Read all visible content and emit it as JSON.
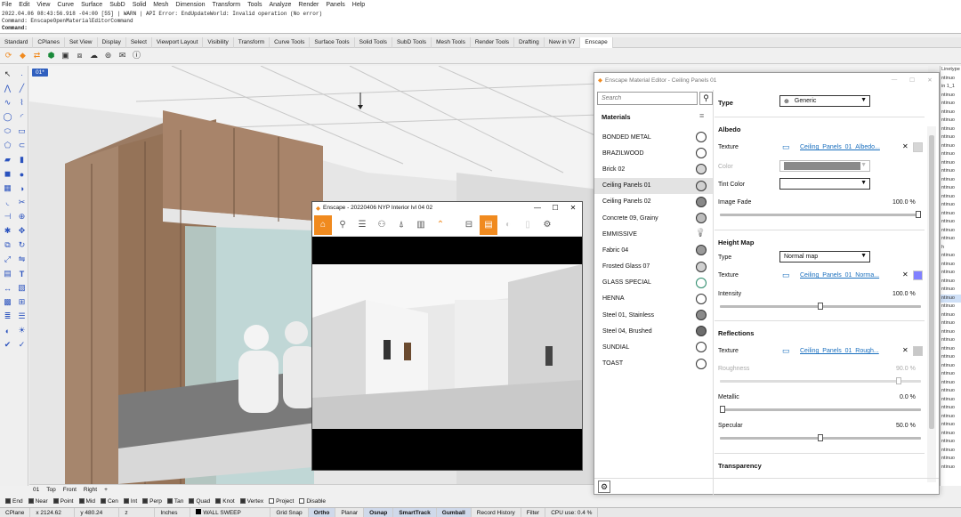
{
  "menu": [
    "File",
    "Edit",
    "View",
    "Curve",
    "Surface",
    "SubD",
    "Solid",
    "Mesh",
    "Dimension",
    "Transform",
    "Tools",
    "Analyze",
    "Render",
    "Panels",
    "Help"
  ],
  "command_history": [
    "2022.04.06 08:43:56.918 -04:00 [55] | WARN | API Error: EndUpdateWorld: Invalid operation (No error)",
    "Command: EnscapeOpenMaterialEditorCommand"
  ],
  "command_prompt": "Command:",
  "toolbar_tabs": [
    "Standard",
    "CPlanes",
    "Set View",
    "Display",
    "Select",
    "Viewport Layout",
    "Visibility",
    "Transform",
    "Curve Tools",
    "Surface Tools",
    "Solid Tools",
    "SubD Tools",
    "Mesh Tools",
    "Render Tools",
    "Drafting",
    "New in V7",
    "Enscape"
  ],
  "active_toolbar_tab": "Enscape",
  "viewport": {
    "label": "01*"
  },
  "view_tabs": [
    "01",
    "Top",
    "Front",
    "Right",
    "+"
  ],
  "osnaps": [
    {
      "label": "End",
      "on": true
    },
    {
      "label": "Near",
      "on": true
    },
    {
      "label": "Point",
      "on": true
    },
    {
      "label": "Mid",
      "on": true
    },
    {
      "label": "Cen",
      "on": true
    },
    {
      "label": "Int",
      "on": true
    },
    {
      "label": "Perp",
      "on": true
    },
    {
      "label": "Tan",
      "on": true
    },
    {
      "label": "Quad",
      "on": true
    },
    {
      "label": "Knot",
      "on": true
    },
    {
      "label": "Vertex",
      "on": true
    },
    {
      "label": "Project",
      "on": false
    },
    {
      "label": "Disable",
      "on": false
    }
  ],
  "status": {
    "cplane": "CPlane",
    "x": "x 2124.62",
    "y": "y 480.24",
    "z": "z",
    "units": "Inches",
    "layer": "WALL SWEEP",
    "toggles": [
      {
        "label": "Grid Snap",
        "on": false
      },
      {
        "label": "Ortho",
        "on": true
      },
      {
        "label": "Planar",
        "on": false
      },
      {
        "label": "Osnap",
        "on": true
      },
      {
        "label": "SmartTrack",
        "on": true
      },
      {
        "label": "Gumball",
        "on": true
      },
      {
        "label": "Record History",
        "on": false
      },
      {
        "label": "Filter",
        "on": false
      }
    ],
    "cpu": "CPU use: 0.4 %"
  },
  "render_window": {
    "title": "Enscape - 20220406 NYP Interior lvl 04 02",
    "controls": [
      "—",
      "☐",
      "✕"
    ]
  },
  "material_editor": {
    "title": "Enscape Material Editor - Ceiling Panels 01",
    "search_placeholder": "Search",
    "materials_header": "Materials",
    "materials": [
      {
        "name": "BONDED METAL",
        "swatch": "#ffffff"
      },
      {
        "name": "BRAZILWOOD",
        "swatch": "#ffffff"
      },
      {
        "name": "Brick 02",
        "swatch": "#d6d6d6"
      },
      {
        "name": "Ceiling Panels 01",
        "swatch": "#d0d0d0",
        "selected": true
      },
      {
        "name": "Ceiling Panels 02",
        "swatch": "#888888"
      },
      {
        "name": "Concrete 09, Grainy",
        "swatch": "#bdbdbd"
      },
      {
        "name": "EMMISSIVE",
        "swatch": "bulb"
      },
      {
        "name": "Fabric 04",
        "swatch": "#9a9a9a"
      },
      {
        "name": "Frosted Glass 07",
        "swatch": "#d0d0d0"
      },
      {
        "name": "GLASS SPECIAL",
        "swatch": "#ffffff"
      },
      {
        "name": "HENNA",
        "swatch": "#ffffff"
      },
      {
        "name": "Steel 01, Stainless",
        "swatch": "#8a8a8a"
      },
      {
        "name": "Steel 04, Brushed",
        "swatch": "#6d6d6d"
      },
      {
        "name": "SUNDIAL",
        "swatch": "#ffffff"
      },
      {
        "name": "TOAST",
        "swatch": "#ffffff"
      }
    ],
    "type_label": "Type",
    "type_value": "Generic",
    "albedo": {
      "header": "Albedo",
      "texture_label": "Texture",
      "texture_value": "Ceiling_Panels_01_Albedo...",
      "color_label": "Color",
      "tint_label": "Tint Color",
      "image_fade_label": "Image Fade",
      "image_fade_value": "100.0 %",
      "image_fade_fraction": 1.0
    },
    "height_map": {
      "header": "Height Map",
      "type_label": "Type",
      "type_value": "Normal map",
      "texture_label": "Texture",
      "texture_value": "Ceiling_Panels_01_Norma...",
      "intensity_label": "Intensity",
      "intensity_value": "100.0 %",
      "intensity_fraction": 0.5
    },
    "reflections": {
      "header": "Reflections",
      "texture_label": "Texture",
      "texture_value": "Ceiling_Panels_01_Rough...",
      "roughness_label": "Roughness",
      "roughness_value": "90.0 %",
      "roughness_fraction": 0.9,
      "metallic_label": "Metallic",
      "metallic_value": "0.0 %",
      "metallic_fraction": 0.0,
      "specular_label": "Specular",
      "specular_value": "50.0 %",
      "specular_fraction": 0.5
    },
    "transparency_header": "Transparency"
  },
  "right_panel_rows": [
    "Linetype",
    "ntinuo",
    "in 1_1",
    "ntinuo",
    "ntinuo",
    "ntinuo",
    "ntinuo",
    "ntinuo",
    "ntinuo",
    "ntinuo",
    "ntinuo",
    "ntinuo",
    "ntinuo",
    "ntinuo",
    "ntinuo",
    "ntinuo",
    "ntinuo",
    "ntinuo",
    "ntinuo",
    "ntinuo",
    "ntinuo",
    "h",
    "ntinuo",
    "ntinuo",
    "ntinuo",
    "ntinuo",
    "ntinuo",
    "ntinuo",
    "ntinuo",
    "ntinuo",
    "ntinuo",
    "ntinuo",
    "ntinuo",
    "ntinuo",
    "ntinuo",
    "ntinuo",
    "ntinuo",
    "ntinuo",
    "ntinuo",
    "ntinuo",
    "ntinuo",
    "ntinuo",
    "ntinuo",
    "ntinuo",
    "ntinuo",
    "ntinuo",
    "ntinuo",
    "ntinuo"
  ],
  "colors": {
    "accent": "#2f5fbf",
    "orange": "#f08a1f",
    "link": "#1a6fbe",
    "normal_swatch": "#8080ff"
  }
}
